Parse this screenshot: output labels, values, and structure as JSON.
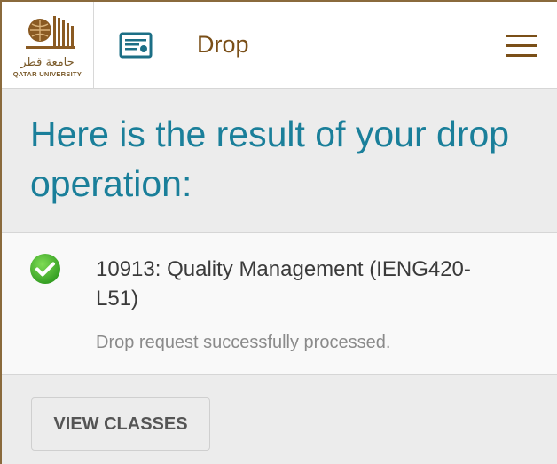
{
  "header": {
    "logo_arabic": "جامعة قطر",
    "logo_english": "QATAR UNIVERSITY",
    "page_title": "Drop",
    "icons": {
      "logo": "qatar-university-logo",
      "page": "certificate-icon",
      "menu": "hamburger-menu-icon"
    }
  },
  "result": {
    "heading": "Here is the result of your drop operation:",
    "item": {
      "title": "10913: Quality Management (IENG420-L51)",
      "message": "Drop request successfully processed.",
      "status_icon": "success-check-icon"
    }
  },
  "actions": {
    "view_classes": "VIEW CLASSES"
  },
  "colors": {
    "brand_brown": "#7a4f18",
    "heading_teal": "#1a7f9a",
    "success_green": "#3fae2a",
    "icon_teal": "#1c6f86"
  }
}
